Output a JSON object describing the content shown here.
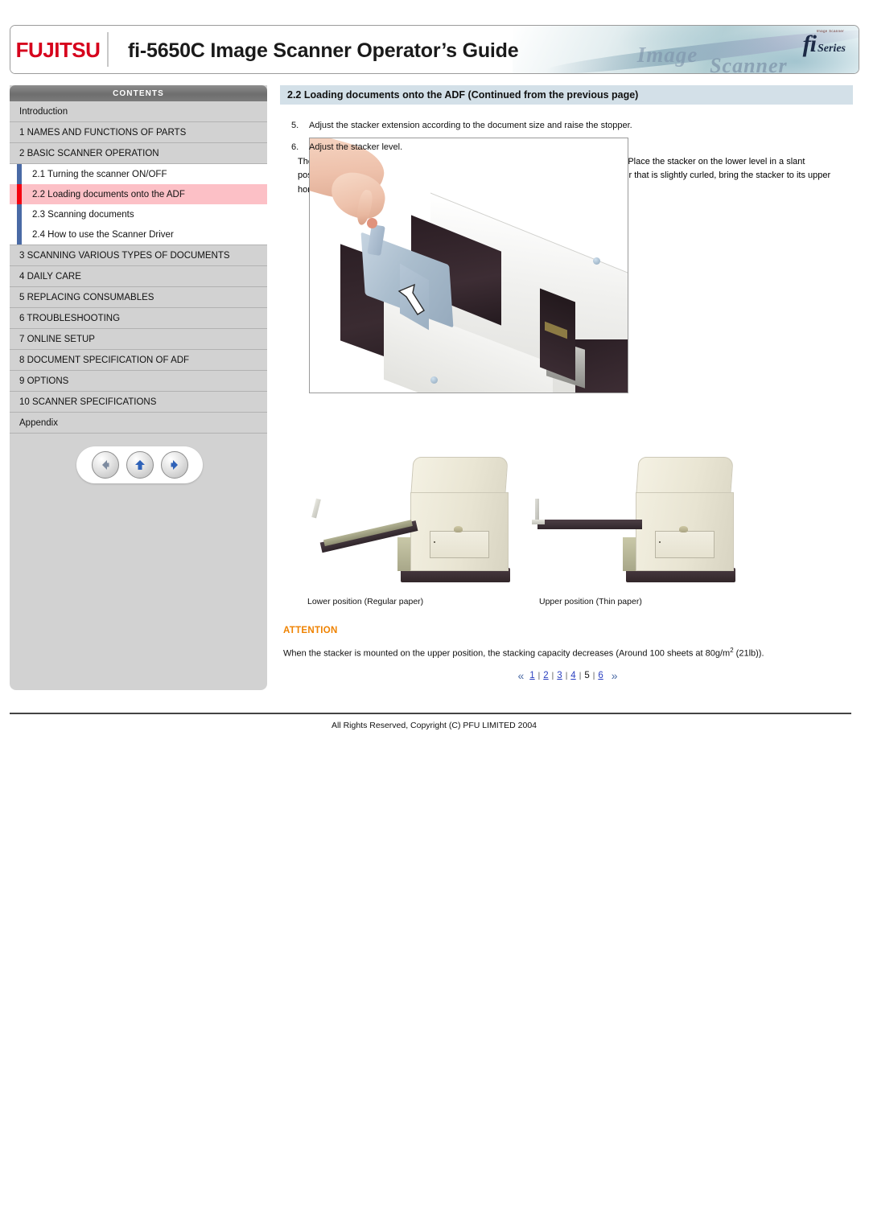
{
  "banner": {
    "logo_text": "FUJITSU",
    "title": "fi-5650C Image Scanner Operator’s Guide",
    "fi_logo": "fi",
    "fi_series": "Series",
    "fi_tagline": "Image Scanner",
    "art_word_image": "Image",
    "art_word_scanner": "Scanner"
  },
  "sidebar": {
    "header": "CONTENTS",
    "items": [
      {
        "label": "Introduction",
        "level": 0
      },
      {
        "label": "1 NAMES AND FUNCTIONS OF PARTS",
        "level": 0
      },
      {
        "label": "2 BASIC SCANNER OPERATION",
        "level": 0
      }
    ],
    "sub_items": [
      {
        "label": "2.1 Turning the scanner ON/OFF",
        "active": false
      },
      {
        "label": "2.2 Loading documents onto the ADF",
        "active": true
      },
      {
        "label": "2.3 Scanning documents",
        "active": false
      },
      {
        "label": "2.4 How to use the Scanner Driver",
        "active": false
      }
    ],
    "items_after": [
      {
        "label": "3 SCANNING VARIOUS TYPES OF DOCUMENTS"
      },
      {
        "label": "4 DAILY CARE"
      },
      {
        "label": "5 REPLACING CONSUMABLES"
      },
      {
        "label": "6 TROUBLESHOOTING"
      },
      {
        "label": "7 ONLINE SETUP"
      },
      {
        "label": "8 DOCUMENT SPECIFICATION OF ADF"
      },
      {
        "label": "9 OPTIONS"
      },
      {
        "label": "10 SCANNER SPECIFICATIONS"
      },
      {
        "label": "Appendix"
      }
    ],
    "nav": {
      "back": "back-arrow-icon",
      "up": "up-arrow-icon",
      "forward": "forward-arrow-icon"
    }
  },
  "content": {
    "section_title": "2.2 Loading documents onto the ADF (Continued from the previous page)",
    "step5": {
      "number": "5.",
      "text": "Adjust the stacker extension according to the document size and raise the stopper."
    },
    "step6": {
      "number": "6.",
      "text": "Adjust the stacker level.",
      "detail": "The level of the stacker can be changed according to the type and amount of paper. Place the stacker on the lower level in a slant position for paper of regular thickness. However, lightweight or thin paper or for paper that is slightly curled, bring the stacker to its upper horizontal position."
    },
    "photo_caption_lower": "Lower position (Regular paper)",
    "photo_caption_upper": "Upper position (Thin paper)",
    "attention": {
      "heading": "ATTENTION",
      "body_before": "When the stacker is mounted on the upper position, the stacking capacity decreases (Around 100 sheets at 80g/m",
      "superscript": "2",
      "body_after": " (21lb))."
    }
  },
  "pager": {
    "prev_icon": "double-left-chevron-icon",
    "next_icon": "double-right-chevron-icon",
    "pages": [
      {
        "label": "1",
        "current": false
      },
      {
        "label": "2",
        "current": false
      },
      {
        "label": "3",
        "current": false
      },
      {
        "label": "4",
        "current": false
      },
      {
        "label": "5",
        "current": true
      },
      {
        "label": "6",
        "current": false
      }
    ],
    "separator": "|"
  },
  "footer": {
    "copyright": "All Rights Reserved, Copyright (C) PFU LIMITED 2004"
  },
  "colors": {
    "brand_red": "#d6001c",
    "section_bar": "#d3e0e8",
    "active_item": "#fcc0c6",
    "active_marker": "#f4000f",
    "sub_marker": "#4a6aa5",
    "attention": "#ef8200",
    "link": "#2a3fc0"
  }
}
